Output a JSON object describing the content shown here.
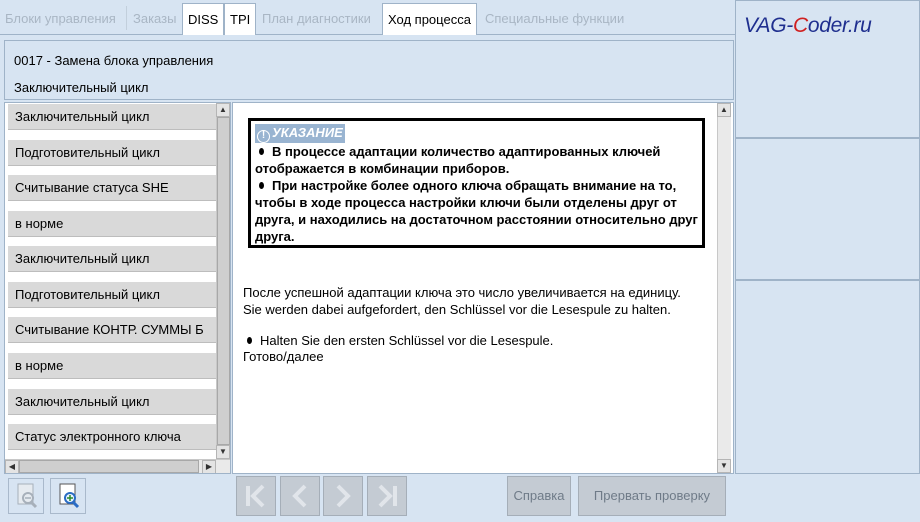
{
  "tabs": [
    {
      "label": "Блоки управления",
      "active": false
    },
    {
      "label": "Заказы",
      "active": false
    },
    {
      "label": "DISS",
      "active": true
    },
    {
      "label": "TPI",
      "active": true
    },
    {
      "label": "План диагностики",
      "active": false
    },
    {
      "label": "Ход процесса",
      "active": true
    },
    {
      "label": "Специальные функции",
      "active": false
    }
  ],
  "logo": {
    "prefix": "VAG-",
    "accent": "C",
    "suffix": "oder.ru"
  },
  "header": {
    "title": "0017 - Замена блока управления",
    "subtitle": "Заключительный цикл"
  },
  "steps": [
    "Заключительный цикл",
    "Подготовительный цикл",
    "Считывание статуса SHE",
    "в норме",
    "Заключительный цикл",
    "Подготовительный цикл",
    "Считывание КОНТР. СУММЫ Б",
    "в норме",
    "Заключительный цикл",
    "Статус электронного ключа"
  ],
  "note": {
    "title": "УКАЗАНИЕ",
    "items": [
      "В процессе адаптации количество адаптированных ключей отображается в комбинации приборов.",
      "При настройке более одного ключа обращать внимание на то, чтобы в ходе процесса настройки ключи были отделены друг от друга, и находились на достаточном расстоянии относительно друг друга."
    ]
  },
  "body": {
    "line1": "После успешной адаптации ключа это число увеличивается на единицу.",
    "line2": "Sie werden dabei aufgefordert, den Schlüssel vor die Lesespule zu halten.",
    "bullet": "Halten Sie den ersten Schlüssel vor die Lesespule.",
    "line3": "Готово/далее"
  },
  "buttons": {
    "help": "Справка",
    "abort": "Прервать проверку"
  },
  "icons": [
    "zoom-out-icon",
    "zoom-in-icon",
    "first-icon",
    "prev-icon",
    "next-icon",
    "last-icon"
  ],
  "colors": {
    "background": "#d7e4f2",
    "note_title_bg": "#99b4d1",
    "disabled_button": "#c4cbd3"
  }
}
